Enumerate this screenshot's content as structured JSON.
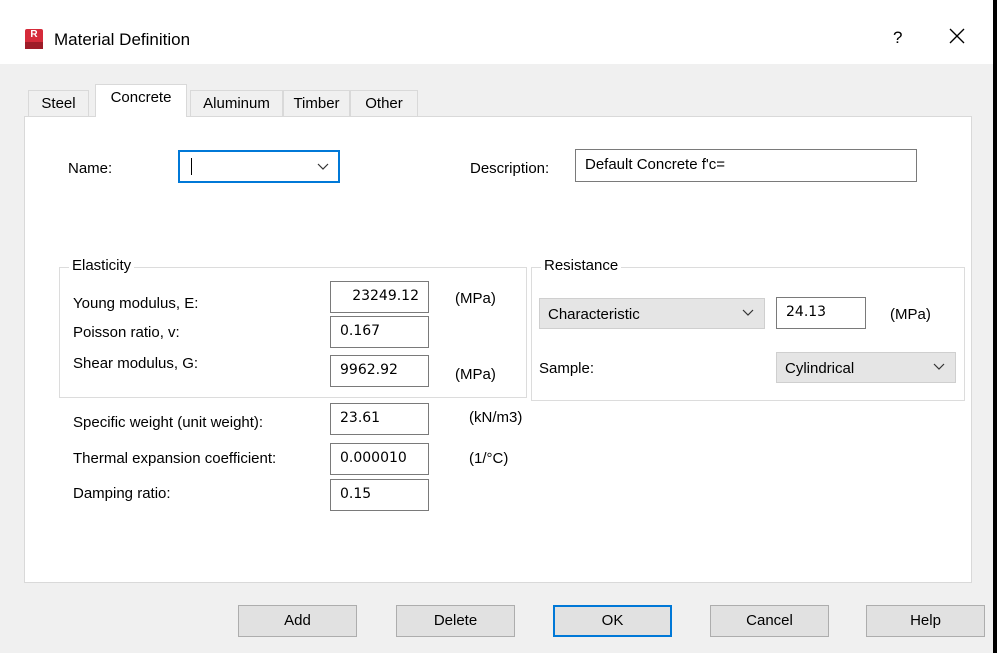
{
  "window": {
    "title": "Material Definition",
    "app_icon_letter": "R",
    "help_glyph": "?",
    "icons": {
      "app": "robot-app-icon",
      "help": "help-icon",
      "close": "close-icon"
    }
  },
  "tabs": [
    {
      "label": "Steel",
      "active": false
    },
    {
      "label": "Concrete",
      "active": true
    },
    {
      "label": "Aluminum",
      "active": false
    },
    {
      "label": "Timber",
      "active": false
    },
    {
      "label": "Other",
      "active": false
    }
  ],
  "form": {
    "name_label": "Name:",
    "name_value": "",
    "description_label": "Description:",
    "description_value": "Default Concrete f'c="
  },
  "elasticity": {
    "title": "Elasticity",
    "young_label": "Young modulus, E:",
    "young_value": "23249.12",
    "young_unit": "(MPa)",
    "poisson_label": "Poisson ratio, v:",
    "poisson_value": "0.167",
    "shear_label": "Shear modulus, G:",
    "shear_value": "9962.92",
    "shear_unit": "(MPa)"
  },
  "resistance": {
    "title": "Resistance",
    "type_value": "Characteristic",
    "value": "24.13",
    "unit": "(MPa)",
    "sample_label": "Sample:",
    "sample_value": "Cylindrical"
  },
  "properties": {
    "specific_weight_label": "Specific weight (unit weight):",
    "specific_weight_value": "23.61",
    "specific_weight_unit": "(kN/m3)",
    "thermal_label": "Thermal expansion coefficient:",
    "thermal_value": "0.000010",
    "thermal_unit": "(1/°C)",
    "damping_label": "Damping ratio:",
    "damping_value": "0.15"
  },
  "buttons": {
    "add": "Add",
    "delete": "Delete",
    "ok": "OK",
    "cancel": "Cancel",
    "help": "Help"
  },
  "colors": {
    "focus_accent": "#0078d7",
    "app_icon": "#d52b3a"
  }
}
